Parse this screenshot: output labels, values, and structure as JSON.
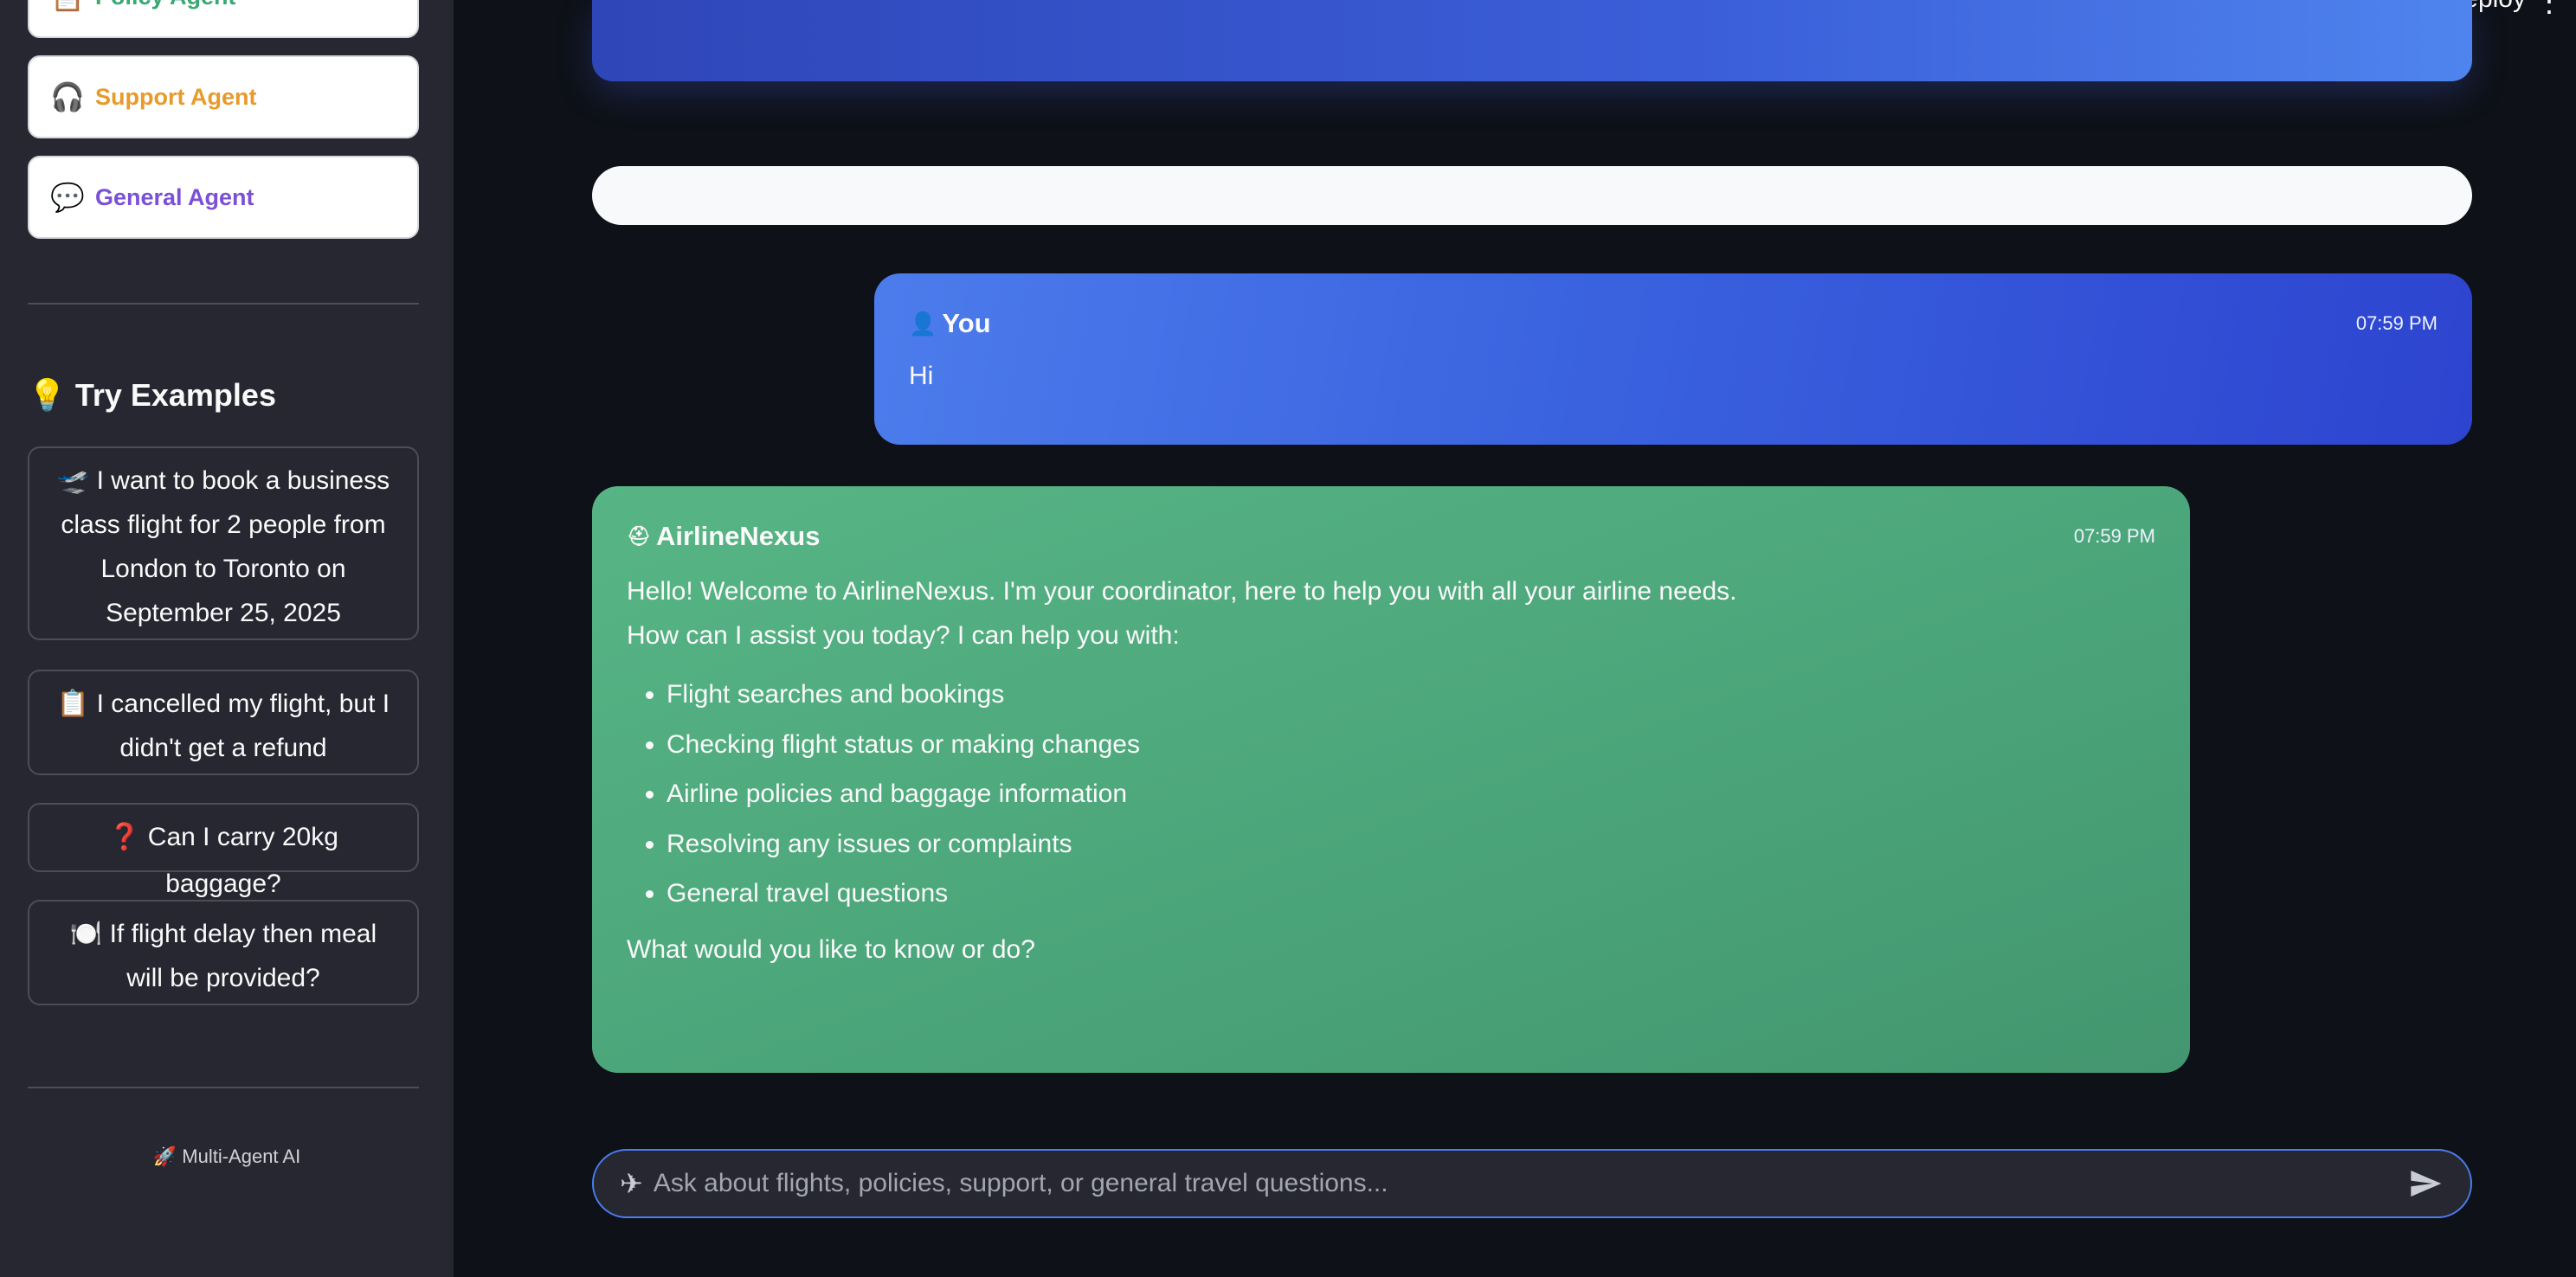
{
  "sidebar": {
    "agents": [
      {
        "label": "Policy Agent",
        "icon": "clipboard-icon",
        "color": "#3aa873"
      },
      {
        "label": "Support Agent",
        "icon": "headphones-icon",
        "color": "#e89a2b"
      },
      {
        "label": "General Agent",
        "icon": "speech-bubble-icon",
        "color": "#7b4fd6"
      }
    ],
    "try_examples_title": "Try Examples",
    "examples": [
      {
        "emoji": "🛫",
        "text": "I want to book a business class flight for 2 people from London to Toronto on September 25, 2025"
      },
      {
        "emoji": "📋",
        "text": "I cancelled my flight, but I didn't get a refund"
      },
      {
        "emoji": "❓",
        "text": "Can I carry 20kg baggage?"
      },
      {
        "emoji": "🍽️",
        "text": "If flight delay then meal will be provided?"
      }
    ],
    "footer": "🚀 Multi-Agent AI"
  },
  "header": {
    "deploy_label": "Deploy"
  },
  "chat": {
    "user_message": {
      "sender": "You",
      "time": "07:59 PM",
      "text": "Hi"
    },
    "bot_message": {
      "sender": "AirlineNexus",
      "time": "07:59 PM",
      "line1": "Hello! Welcome to AirlineNexus. I'm your coordinator, here to help you with all your airline needs.",
      "line2": "How can I assist you today? I can help you with:",
      "bullets": [
        "Flight searches and bookings",
        "Checking flight status or making changes",
        "Airline policies and baggage information",
        "Resolving any issues or complaints",
        "General travel questions"
      ],
      "closing": "What would you like to know or do?"
    }
  },
  "input": {
    "placeholder": "Ask about flights, policies, support, or general travel questions..."
  }
}
